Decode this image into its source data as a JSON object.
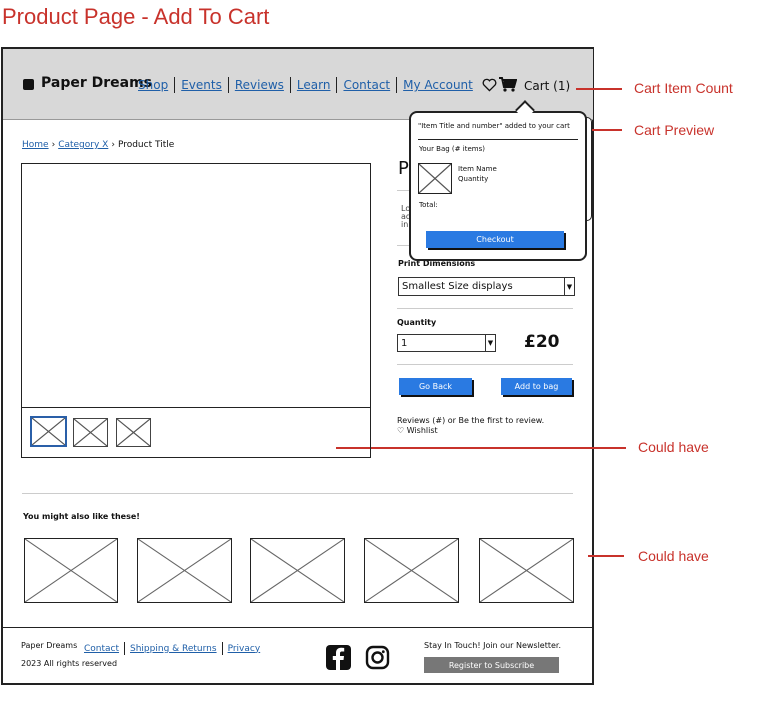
{
  "page_title": "Product Page - Add To Cart",
  "colors": {
    "annotation": "#c8322b",
    "link": "#1f5fa8",
    "button": "#2a7ae2",
    "header_bg": "#d8d8d8"
  },
  "header": {
    "brand": "Paper Dreams",
    "nav": [
      "Shop",
      "Events",
      "Reviews",
      "Learn",
      "Contact",
      "My Account"
    ],
    "cart_label": "Cart (1)",
    "icons": [
      "heart-icon",
      "cart-icon"
    ]
  },
  "annotations": {
    "cart_item_count": "Cart Item Count",
    "cart_preview": "Cart Preview",
    "could_have_1": "Could have",
    "could_have_2": "Could have"
  },
  "breadcrumb": {
    "home": "Home",
    "category": "Category X",
    "current": "Product Title"
  },
  "product": {
    "title_initial": "P",
    "description_lines": [
      "Lo",
      "ad",
      "in"
    ],
    "print_dimensions_label": "Print Dimensions",
    "size_select_value": "Smallest Size displays",
    "quantity_label": "Quantity",
    "quantity_value": "1",
    "price": "£20",
    "go_back": "Go Back",
    "add_to_bag": "Add to bag",
    "reviews_text": "Reviews (#) or Be the first to review.",
    "wishlist": "Wishlist"
  },
  "cart_popup": {
    "message": "\"Item Title and number\" added to your cart",
    "bag_label": "Your Bag (# items)",
    "item_name": "Item Name",
    "item_qty": "Quantity",
    "total": "Total:",
    "checkout": "Checkout"
  },
  "recommendations": {
    "heading": "You might also like these!"
  },
  "footer": {
    "brand": "Paper Dreams",
    "rights": "2023 All rights reserved",
    "links": [
      "Contact",
      "Shipping & Returns",
      "Privacy"
    ],
    "newsletter_text": "Stay In Touch! Join our Newsletter.",
    "subscribe": "Register to Subscribe",
    "social_icons": [
      "facebook-icon",
      "instagram-icon"
    ]
  }
}
